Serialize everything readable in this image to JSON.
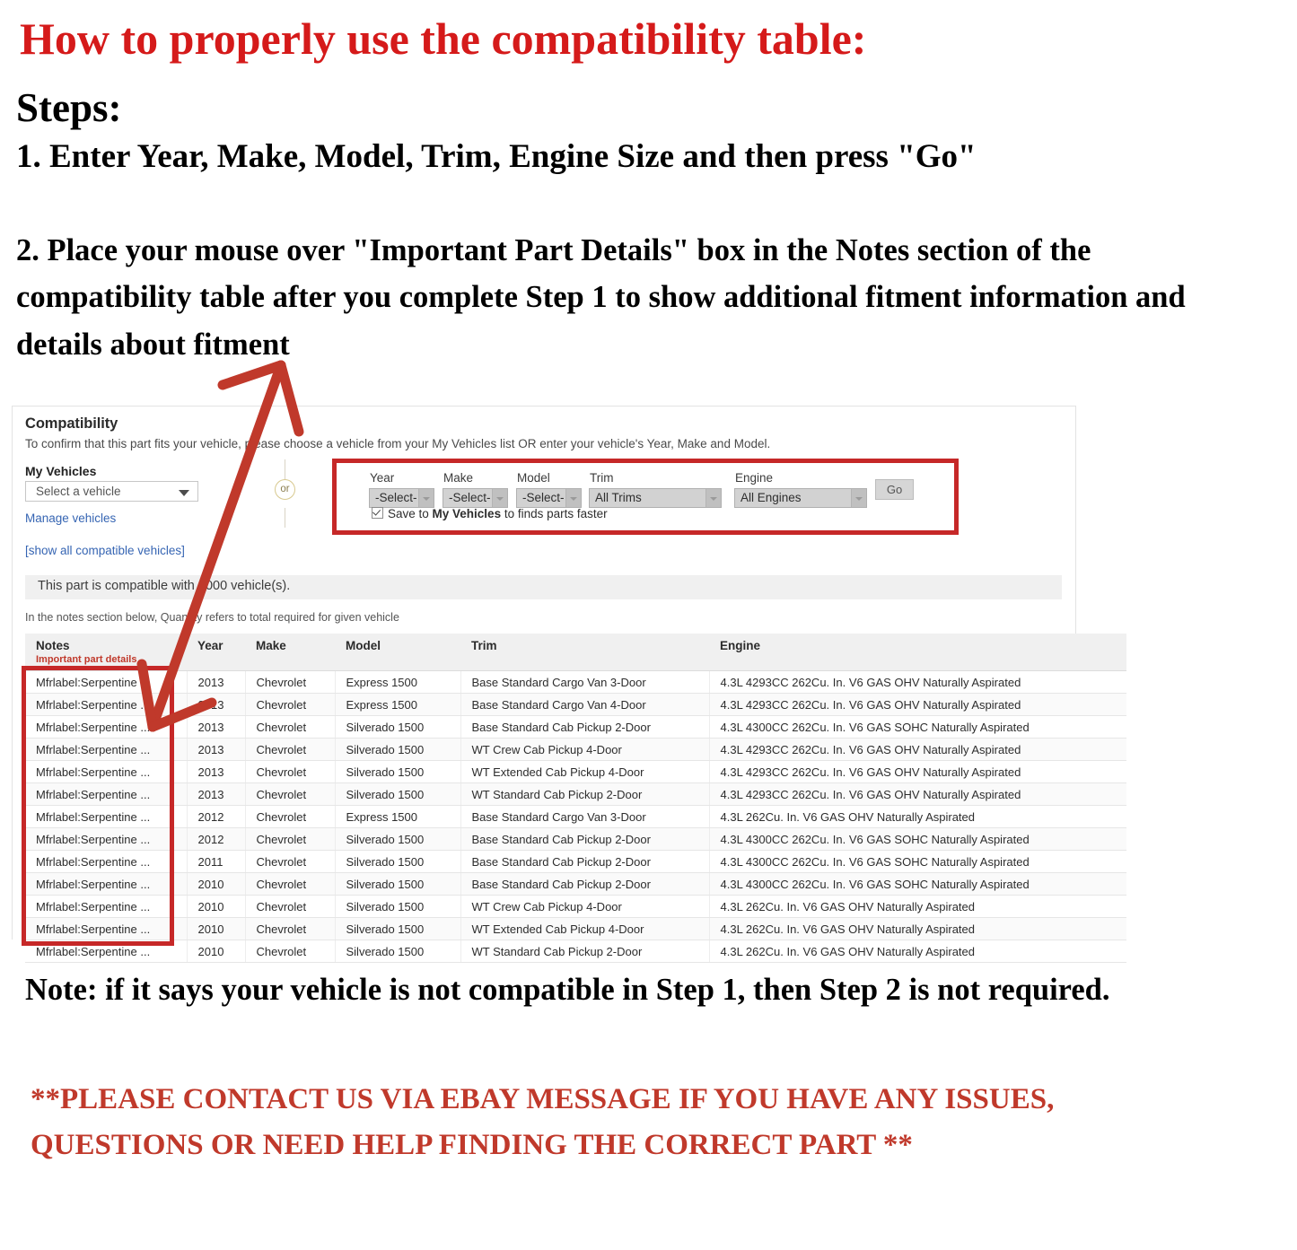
{
  "headline": "How to properly use the compatibility table:",
  "steps_label": "Steps:",
  "step1": "1. Enter Year, Make, Model, Trim, Engine Size and then press \"Go\"",
  "step2": "2. Place your mouse over \"Important Part Details\" box in the Notes section of the compatibility table after you complete Step 1 to show additional fitment information and details about fitment",
  "bottom_note": "Note: if it says your vehicle is not compatible in Step 1, then Step 2 is not required.",
  "contact_note": "**PLEASE CONTACT US VIA EBAY MESSAGE IF YOU HAVE ANY ISSUES, QUESTIONS OR NEED HELP FINDING THE CORRECT PART **",
  "panel": {
    "title": "Compatibility",
    "subtitle": "To confirm that this part fits your vehicle, please choose a vehicle from your My Vehicles list OR enter your vehicle's Year, Make and Model.",
    "my_vehicles": {
      "label": "My Vehicles",
      "select_value": "Select a vehicle",
      "manage_link": "Manage vehicles",
      "show_all_link": "[show all compatible vehicles]"
    },
    "or_divider": "or",
    "form": {
      "fields": [
        {
          "label": "Year",
          "value": "-Select-"
        },
        {
          "label": "Make",
          "value": "-Select-"
        },
        {
          "label": "Model",
          "value": "-Select-"
        },
        {
          "label": "Trim",
          "value": "All Trims"
        },
        {
          "label": "Engine",
          "value": "All Engines"
        }
      ],
      "go_button": "Go",
      "save_prefix": "Save to ",
      "save_strong": "My Vehicles",
      "save_suffix": " to finds parts faster",
      "save_checked": true
    },
    "compatible_bar": "This part is compatible with 1000 vehicle(s).",
    "notes_hint": "In the notes section below, Quantity refers to total required for given vehicle"
  },
  "table": {
    "headers": {
      "notes": "Notes",
      "notes_sub": "Important part details",
      "year": "Year",
      "make": "Make",
      "model": "Model",
      "trim": "Trim",
      "engine": "Engine"
    },
    "rows": [
      {
        "notes": "Mfrlabel:Serpentine ...",
        "year": "2013",
        "make": "Chevrolet",
        "model": "Express 1500",
        "trim": "Base Standard Cargo Van 3-Door",
        "engine": "4.3L 4293CC 262Cu. In. V6 GAS OHV Naturally Aspirated"
      },
      {
        "notes": "Mfrlabel:Serpentine ...",
        "year": "2013",
        "make": "Chevrolet",
        "model": "Express 1500",
        "trim": "Base Standard Cargo Van 4-Door",
        "engine": "4.3L 4293CC 262Cu. In. V6 GAS OHV Naturally Aspirated"
      },
      {
        "notes": "Mfrlabel:Serpentine ...",
        "year": "2013",
        "make": "Chevrolet",
        "model": "Silverado 1500",
        "trim": "Base Standard Cab Pickup 2-Door",
        "engine": "4.3L 4300CC 262Cu. In. V6 GAS SOHC Naturally Aspirated"
      },
      {
        "notes": "Mfrlabel:Serpentine ...",
        "year": "2013",
        "make": "Chevrolet",
        "model": "Silverado 1500",
        "trim": "WT Crew Cab Pickup 4-Door",
        "engine": "4.3L 4293CC 262Cu. In. V6 GAS OHV Naturally Aspirated"
      },
      {
        "notes": "Mfrlabel:Serpentine ...",
        "year": "2013",
        "make": "Chevrolet",
        "model": "Silverado 1500",
        "trim": "WT Extended Cab Pickup 4-Door",
        "engine": "4.3L 4293CC 262Cu. In. V6 GAS OHV Naturally Aspirated"
      },
      {
        "notes": "Mfrlabel:Serpentine ...",
        "year": "2013",
        "make": "Chevrolet",
        "model": "Silverado 1500",
        "trim": "WT Standard Cab Pickup 2-Door",
        "engine": "4.3L 4293CC 262Cu. In. V6 GAS OHV Naturally Aspirated"
      },
      {
        "notes": "Mfrlabel:Serpentine ...",
        "year": "2012",
        "make": "Chevrolet",
        "model": "Express 1500",
        "trim": "Base Standard Cargo Van 3-Door",
        "engine": "4.3L 262Cu. In. V6 GAS OHV Naturally Aspirated"
      },
      {
        "notes": "Mfrlabel:Serpentine ...",
        "year": "2012",
        "make": "Chevrolet",
        "model": "Silverado 1500",
        "trim": "Base Standard Cab Pickup 2-Door",
        "engine": "4.3L 4300CC 262Cu. In. V6 GAS SOHC Naturally Aspirated"
      },
      {
        "notes": "Mfrlabel:Serpentine ...",
        "year": "2011",
        "make": "Chevrolet",
        "model": "Silverado 1500",
        "trim": "Base Standard Cab Pickup 2-Door",
        "engine": "4.3L 4300CC 262Cu. In. V6 GAS SOHC Naturally Aspirated"
      },
      {
        "notes": "Mfrlabel:Serpentine ...",
        "year": "2010",
        "make": "Chevrolet",
        "model": "Silverado 1500",
        "trim": "Base Standard Cab Pickup 2-Door",
        "engine": "4.3L 4300CC 262Cu. In. V6 GAS SOHC Naturally Aspirated"
      },
      {
        "notes": "Mfrlabel:Serpentine ...",
        "year": "2010",
        "make": "Chevrolet",
        "model": "Silverado 1500",
        "trim": "WT Crew Cab Pickup 4-Door",
        "engine": "4.3L 262Cu. In. V6 GAS OHV Naturally Aspirated"
      },
      {
        "notes": "Mfrlabel:Serpentine ...",
        "year": "2010",
        "make": "Chevrolet",
        "model": "Silverado 1500",
        "trim": "WT Extended Cab Pickup 4-Door",
        "engine": "4.3L 262Cu. In. V6 GAS OHV Naturally Aspirated"
      },
      {
        "notes": "Mfrlabel:Serpentine ...",
        "year": "2010",
        "make": "Chevrolet",
        "model": "Silverado 1500",
        "trim": "WT Standard Cab Pickup 2-Door",
        "engine": "4.3L 262Cu. In. V6 GAS OHV Naturally Aspirated"
      }
    ]
  },
  "colors": {
    "headline_red": "#d51a1a",
    "highlight_red": "#c62828",
    "arrow_red": "#c0392b",
    "link_blue": "#3665b3"
  }
}
